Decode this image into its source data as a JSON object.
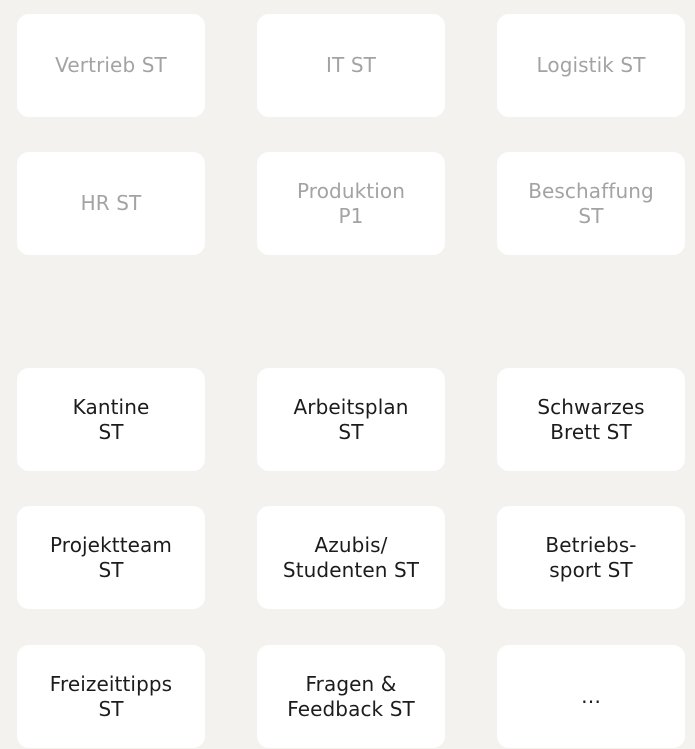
{
  "groups": {
    "departments": [
      "Vertrieb ST",
      "IT ST",
      "Logistik ST",
      "HR ST",
      "Produktion\nP1",
      "Beschaffung\nST"
    ],
    "topics": [
      "Kantine\nST",
      "Arbeitsplan\nST",
      "Schwarzes\nBrett  ST",
      "Projektteam\nST",
      "Azubis/\nStudenten ST",
      "Betriebs-\nsport ST",
      "Freizeittipps\nST",
      "Fragen &\nFeedback ST",
      "…"
    ]
  },
  "colors": {
    "background": "#f3f2ef",
    "tile": "#ffffff",
    "muted_text": "#a3a3a3",
    "active_text": "#1c1c1c"
  }
}
